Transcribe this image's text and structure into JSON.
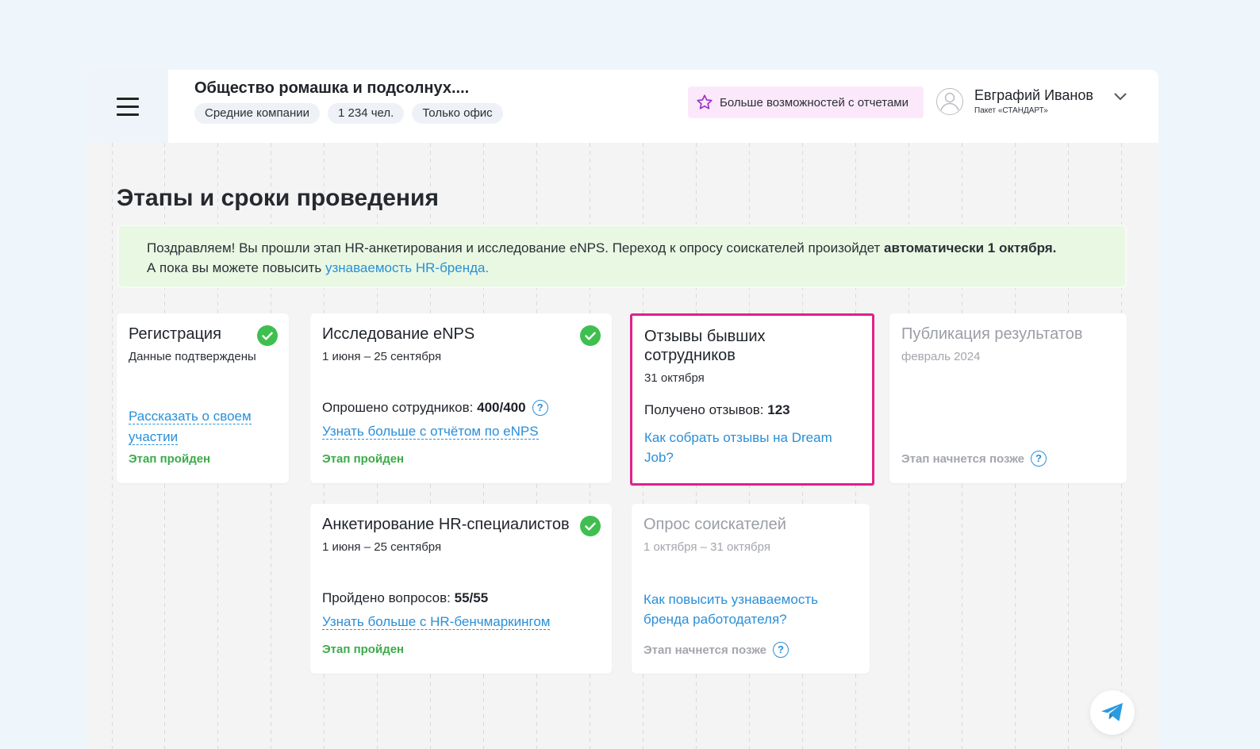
{
  "header": {
    "company_title": "Общество ромашка и подсолнух....",
    "chips": [
      "Средние компании",
      "1 234 чел.",
      "Только офис"
    ],
    "promo_label": "Больше возможностей с отчетами",
    "user_name": "Евграфий Иванов",
    "user_plan": "Пакет «СТАНДАРТ»"
  },
  "section_title": "Этапы и сроки проведения",
  "banner": {
    "text_1": "Поздравляем! Вы прошли этап HR-анкетирования и исследование eNPS. Переход к опросу соискателей произойдет ",
    "text_bold": "автоматически 1 октября.",
    "text_2": "А пока вы можете повысить ",
    "link": "узнаваемость HR-бренда."
  },
  "cards": {
    "registration": {
      "title": "Регистрация",
      "subtitle": "Данные подтверждены",
      "link": "Рассказать о своем участии",
      "status": "Этап пройден"
    },
    "enps": {
      "title": "Исследование eNPS",
      "date": "1 июня – 25 сентября",
      "stat_label": "Опрошено сотрудников: ",
      "stat_value": "400/400",
      "link": "Узнать больше с отчётом по eNPS",
      "status": "Этап пройден"
    },
    "reviews": {
      "title": "Отзывы бывших сотрудников",
      "date": "31 октября",
      "stat_label": "Получено отзывов: ",
      "stat_value": "123",
      "link": "Как собрать отзывы на Dream Job?"
    },
    "publication": {
      "title": "Публикация результатов",
      "date": "февраль 2024",
      "status": "Этап начнется позже"
    },
    "hr_survey": {
      "title": "Анкетирование HR-специалистов",
      "date": "1 июня – 25 сентября",
      "stat_label": "Пройдено вопросов: ",
      "stat_value": "55/55",
      "link": "Узнать больше с HR-бенчмаркингом",
      "status": "Этап пройден"
    },
    "applicants": {
      "title": "Опрос соискателей",
      "date": "1 октября – 31 октября",
      "link": "Как повысить узнаваемость бренда работодателя?",
      "status": "Этап начнется позже"
    }
  },
  "colors": {
    "accent_blue": "#2a8fd8",
    "success_green": "#3cab4a",
    "highlight_pink": "#e0208c",
    "banner_bg": "#e8f8e3",
    "promo_bg": "#fbe9fb"
  },
  "icons": {
    "menu": "hamburger-icon",
    "promo": "star-icon",
    "avatar": "user-avatar-icon",
    "dropdown": "chevron-down-icon",
    "done": "check-circle-icon",
    "help": "question-icon",
    "fab": "telegram-icon"
  }
}
